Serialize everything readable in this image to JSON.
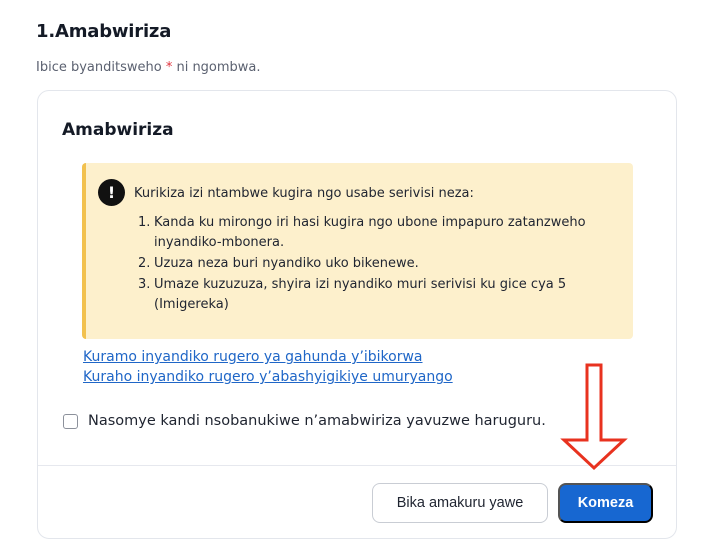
{
  "section": {
    "title": "1.Amabwiriza",
    "required_prefix": "Ibice byanditsweho ",
    "required_star": "*",
    "required_suffix": " ni ngombwa."
  },
  "card": {
    "title": "Amabwiriza",
    "alert": {
      "icon": "exclamation-icon",
      "icon_glyph": "!",
      "intro": "Kurikiza izi ntambwe kugira ngo usabe serivisi neza:",
      "steps": [
        {
          "num": "1.",
          "text": "Kanda ku mirongo iri hasi kugira ngo ubone impapuro zatanzweho inyandiko-mbonera."
        },
        {
          "num": "2.",
          "text": "Uzuza neza buri nyandiko uko bikenewe."
        },
        {
          "num": "3.",
          "text": "Umaze kuzuzuza, shyira izi nyandiko muri serivisi ku gice cya 5 (Imigereka)"
        }
      ]
    },
    "links": [
      "Kuramo inyandiko rugero ya gahunda y’ibikorwa",
      "Kuraho inyandiko rugero y’abashyigikiye umuryango"
    ],
    "agree_label": "Nasomye kandi nsobanukiwe n’amabwiriza yavuzwe haruguru.",
    "buttons": {
      "secondary": "Bika amakuru yawe",
      "primary": "Komeza"
    }
  },
  "colors": {
    "primary": "#1767d1",
    "alert_bg": "#fdf0cc",
    "alert_border": "#f2c14e",
    "link": "#1f66c7",
    "required": "#e0323c",
    "arrow": "#e8321f"
  }
}
